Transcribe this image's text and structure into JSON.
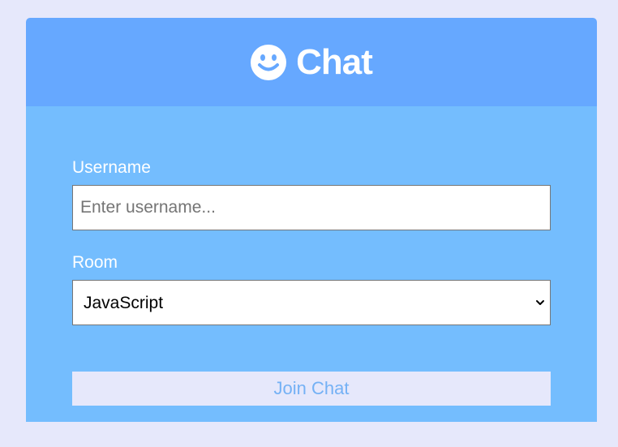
{
  "header": {
    "icon": "smile-icon",
    "title": "Chat"
  },
  "form": {
    "username": {
      "label": "Username",
      "placeholder": "Enter username...",
      "value": ""
    },
    "room": {
      "label": "Room",
      "selected": "JavaScript"
    },
    "join_label": "Join Chat"
  },
  "colors": {
    "page_background": "#e6e8fb",
    "header_background": "#66a8ff",
    "body_background": "#74bdfe",
    "button_background": "#e6e8fb",
    "button_text": "#74b1f5"
  }
}
